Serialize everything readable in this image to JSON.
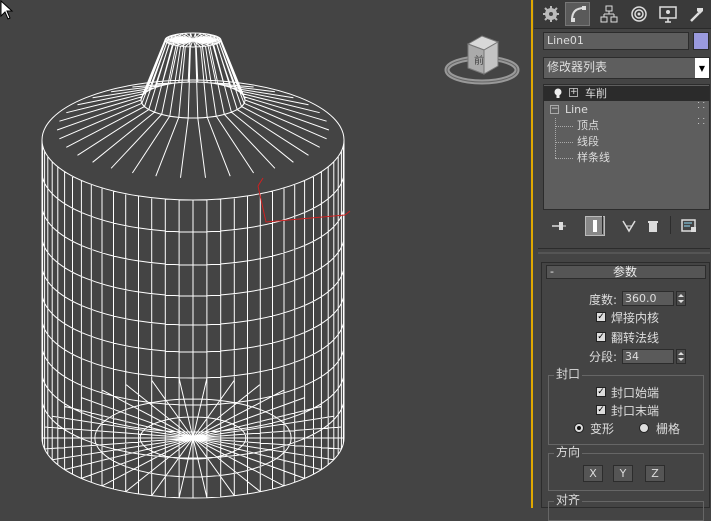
{
  "command_panel": {
    "tabs": [
      "create-icon",
      "modify-icon",
      "hierarchy-icon",
      "motion-icon",
      "display-icon",
      "utilities-icon"
    ],
    "active_tab": "modify",
    "object_name": "Line01",
    "object_color": "#9a9ade",
    "modifier_list": "修改器列表",
    "stack": {
      "modifier": "车削",
      "base_object": "Line",
      "sub_objects": [
        "顶点",
        "线段",
        "样条线"
      ]
    }
  },
  "parameters": {
    "title": "参数",
    "degrees_label": "度数:",
    "degrees_value": "360.0",
    "weld_core": "焊接内核",
    "flip_normals": "翻转法线",
    "segments_label": "分段:",
    "segments_value": "34",
    "capping": {
      "title": "封口",
      "cap_start": "封口始端",
      "cap_end": "封口末端",
      "morph": "变形",
      "grid": "栅格"
    },
    "direction": {
      "title": "方向",
      "buttons": [
        "X",
        "Y",
        "Z"
      ]
    },
    "align": {
      "title": "对齐"
    }
  },
  "viewcube": {
    "face": "前"
  },
  "colors": {
    "viewport_bg": "#444444",
    "wire": "#ffffff",
    "active_border": "#e0a800"
  }
}
